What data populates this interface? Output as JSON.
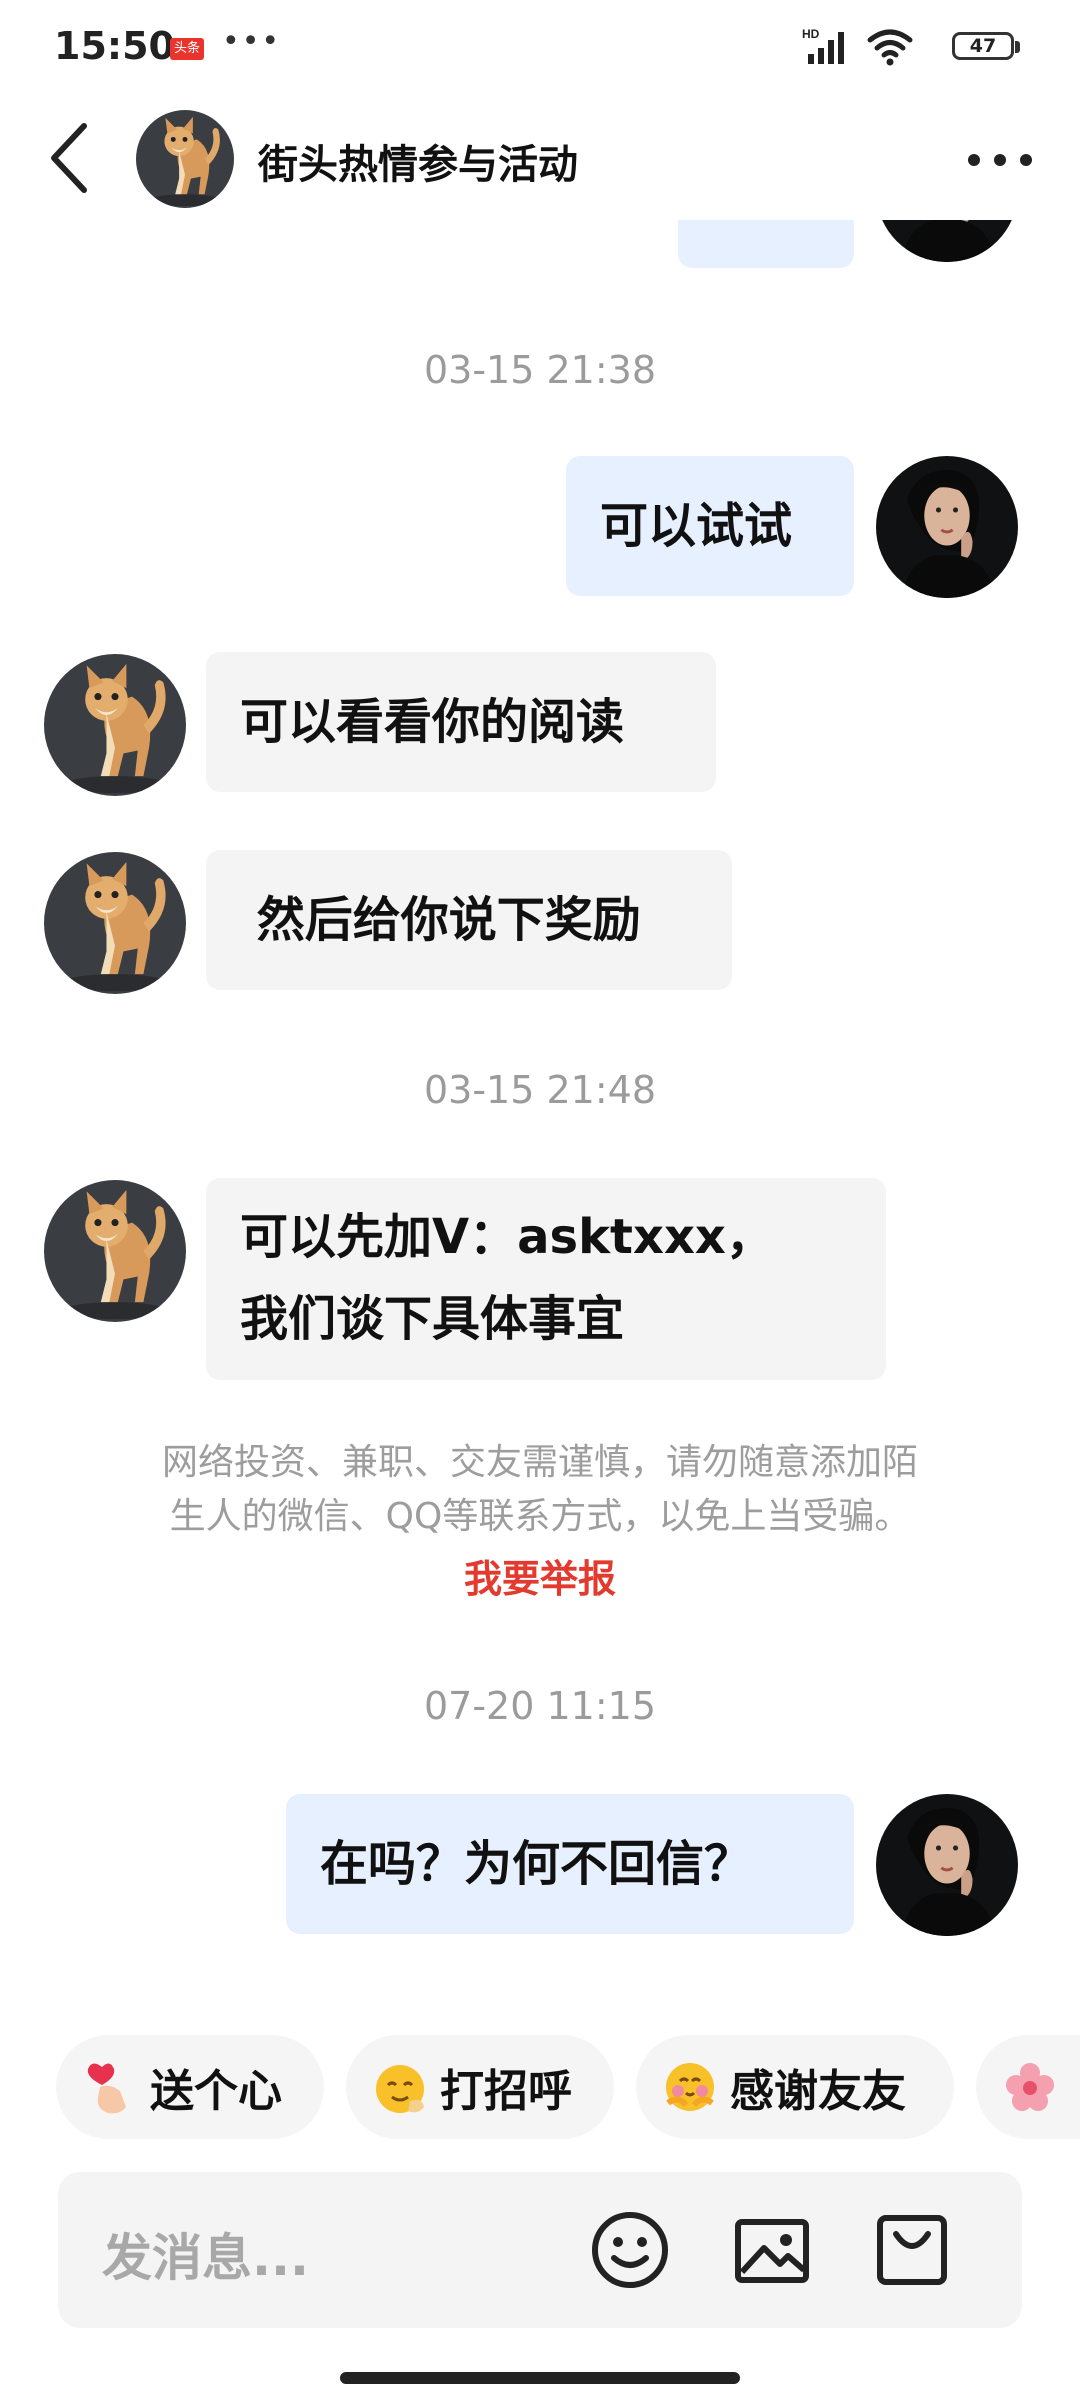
{
  "status_bar": {
    "time": "15:50",
    "app_badge": "头条",
    "dots": "•••",
    "network": "HD",
    "battery": "47"
  },
  "header": {
    "title": "街头热情参与活动"
  },
  "messages": {
    "ts1": "03-15 21:38",
    "out1": "可以试试",
    "in1": "可以看看你的阅读",
    "in2": " 然后给你说下奖励",
    "ts2": "03-15 21:48",
    "in3_line1": "可以先加V：asktxxx，",
    "in3_line2": "我们谈下具体事宜",
    "warning_line1": "网络投资、兼职、交友需谨慎，请勿随意添加陌",
    "warning_line2": "生人的微信、QQ等联系方式，以免上当受骗。",
    "report": "我要举报",
    "ts3": "07-20 11:15",
    "out2": "在吗？为何不回信？"
  },
  "quick_replies": [
    {
      "label": "送个心",
      "icon": "heart-gesture-icon"
    },
    {
      "label": "打招呼",
      "icon": "wave-emoji-icon"
    },
    {
      "label": "感谢友友",
      "icon": "hug-emoji-icon"
    },
    {
      "label": "",
      "icon": "flower-icon"
    }
  ],
  "input": {
    "placeholder": "发消息..."
  },
  "colors": {
    "outgoing_bubble": "#e6f0fe",
    "incoming_bubble": "#f4f4f4",
    "report_red": "#e23a2e",
    "timestamp_gray": "#9b9b9b"
  }
}
